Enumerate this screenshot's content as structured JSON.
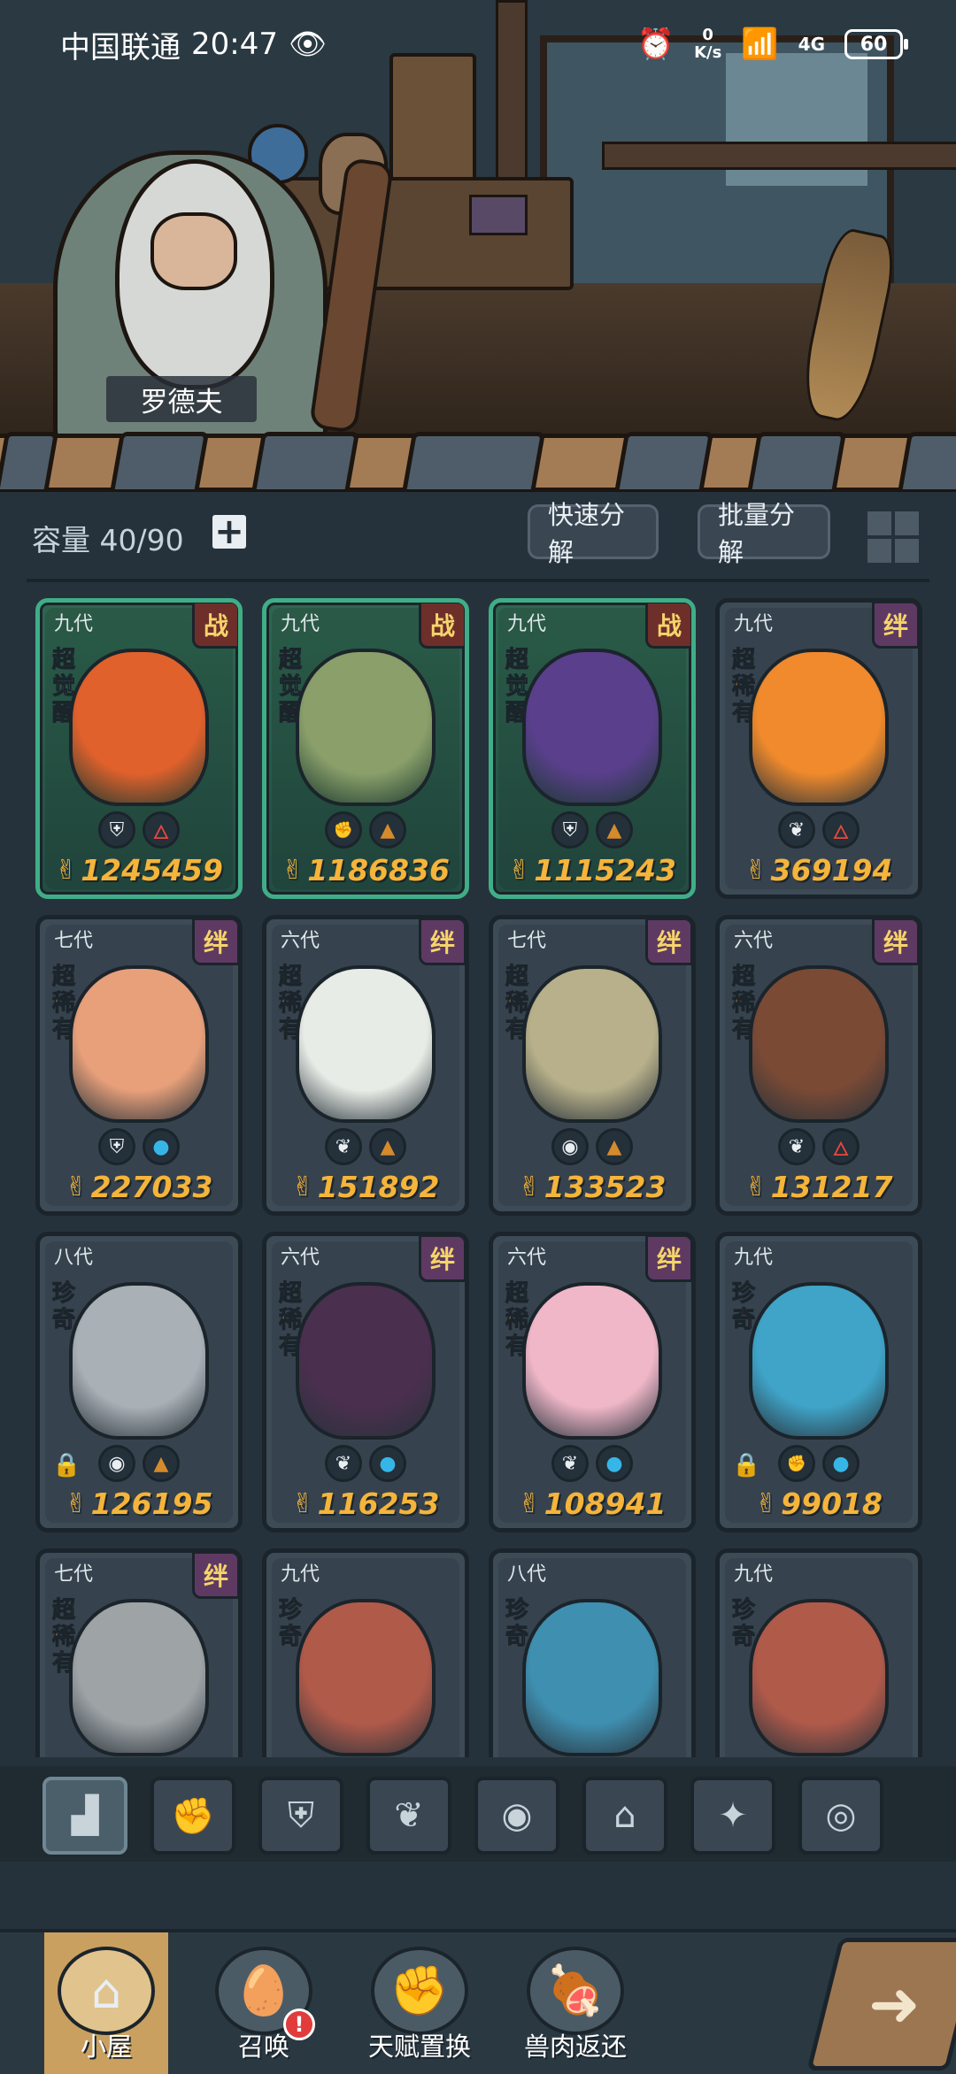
{
  "status_bar": {
    "carrier": "中国联通",
    "time": "20:47",
    "net_speed_value": "0",
    "net_speed_unit": "K/s",
    "network": "4G",
    "battery": "60"
  },
  "scene": {
    "npc_name": "罗德夫"
  },
  "toolbar": {
    "capacity_label": "容量 40/90",
    "add_icon": "plus-icon",
    "quick_decompose": "快速分解",
    "batch_decompose": "批量分解",
    "view_toggle_icon": "grid-view-icon"
  },
  "cards": [
    {
      "gen": "九代",
      "badge": "战",
      "rarity": "超觉醒",
      "traits": [
        "shield",
        "fire"
      ],
      "power": "1245459",
      "locked": false,
      "style": "awaken",
      "color": "#e0612c"
    },
    {
      "gen": "九代",
      "badge": "战",
      "rarity": "超觉醒",
      "traits": [
        "fist",
        "earth"
      ],
      "power": "1186836",
      "locked": false,
      "style": "awaken",
      "color": "#8a9f6a"
    },
    {
      "gen": "九代",
      "badge": "战",
      "rarity": "超觉醒",
      "traits": [
        "shield",
        "earth"
      ],
      "power": "1115243",
      "locked": false,
      "style": "awaken",
      "color": "#5a3f8c"
    },
    {
      "gen": "九代",
      "badge": "绊",
      "rarity": "超稀有",
      "traits": [
        "leaf",
        "fire"
      ],
      "power": "369194",
      "locked": false,
      "style": "normal",
      "color": "#f08a2c"
    },
    {
      "gen": "七代",
      "badge": "绊",
      "rarity": "超稀有",
      "traits": [
        "shield",
        "water"
      ],
      "power": "227033",
      "locked": false,
      "style": "normal",
      "color": "#e8a07a"
    },
    {
      "gen": "六代",
      "badge": "绊",
      "rarity": "超稀有",
      "traits": [
        "leaf",
        "earth"
      ],
      "power": "151892",
      "locked": false,
      "style": "normal",
      "color": "#e8ece6"
    },
    {
      "gen": "七代",
      "badge": "绊",
      "rarity": "超稀有",
      "traits": [
        "eye",
        "earth"
      ],
      "power": "133523",
      "locked": false,
      "style": "normal",
      "color": "#b7b08a"
    },
    {
      "gen": "六代",
      "badge": "绊",
      "rarity": "超稀有",
      "traits": [
        "leaf",
        "fire"
      ],
      "power": "131217",
      "locked": false,
      "style": "normal",
      "color": "#7a4a35"
    },
    {
      "gen": "八代",
      "badge": "",
      "rarity": "珍奇",
      "traits": [
        "eye",
        "earth"
      ],
      "power": "126195",
      "locked": true,
      "style": "normal",
      "color": "#a9b1b6"
    },
    {
      "gen": "六代",
      "badge": "绊",
      "rarity": "超稀有",
      "traits": [
        "leaf",
        "water"
      ],
      "power": "116253",
      "locked": false,
      "style": "normal",
      "color": "#4a2f4e"
    },
    {
      "gen": "六代",
      "badge": "绊",
      "rarity": "超稀有",
      "traits": [
        "leaf",
        "water"
      ],
      "power": "108941",
      "locked": false,
      "style": "normal",
      "color": "#f0b7c8"
    },
    {
      "gen": "九代",
      "badge": "",
      "rarity": "珍奇",
      "traits": [
        "fist",
        "water"
      ],
      "power": "99018",
      "locked": true,
      "style": "normal",
      "color": "#3fa4c8"
    },
    {
      "gen": "七代",
      "badge": "绊",
      "rarity": "超稀有",
      "traits": [],
      "power": "",
      "locked": false,
      "style": "normal",
      "color": "#9ea3a6"
    },
    {
      "gen": "九代",
      "badge": "",
      "rarity": "珍奇",
      "traits": [],
      "power": "",
      "locked": false,
      "style": "normal",
      "color": "#b05a4a"
    },
    {
      "gen": "八代",
      "badge": "",
      "rarity": "珍奇",
      "traits": [],
      "power": "",
      "locked": false,
      "style": "normal",
      "color": "#3f8fb0"
    },
    {
      "gen": "九代",
      "badge": "",
      "rarity": "珍奇",
      "traits": [],
      "power": "",
      "locked": false,
      "style": "normal",
      "color": "#b05a4a"
    }
  ],
  "filters": [
    {
      "icon": "all-blocks-icon",
      "active": true
    },
    {
      "icon": "fist-icon",
      "active": false
    },
    {
      "icon": "shield-icon",
      "active": false
    },
    {
      "icon": "leaf-icon",
      "active": false
    },
    {
      "icon": "eye-icon",
      "active": false
    },
    {
      "icon": "tower-icon",
      "active": false
    },
    {
      "icon": "star-compass-icon",
      "active": false
    },
    {
      "icon": "swirl-icon",
      "active": false
    }
  ],
  "nav": {
    "items": [
      {
        "label": "小屋",
        "icon": "hut-icon",
        "active": true
      },
      {
        "label": "召唤",
        "icon": "egg-icon",
        "active": false,
        "alert": "!"
      },
      {
        "label": "天赋置换",
        "icon": "fist-icon",
        "active": false
      },
      {
        "label": "兽肉返还",
        "icon": "meat-icon",
        "active": false
      }
    ],
    "next_icon": "arrow-right-icon"
  }
}
